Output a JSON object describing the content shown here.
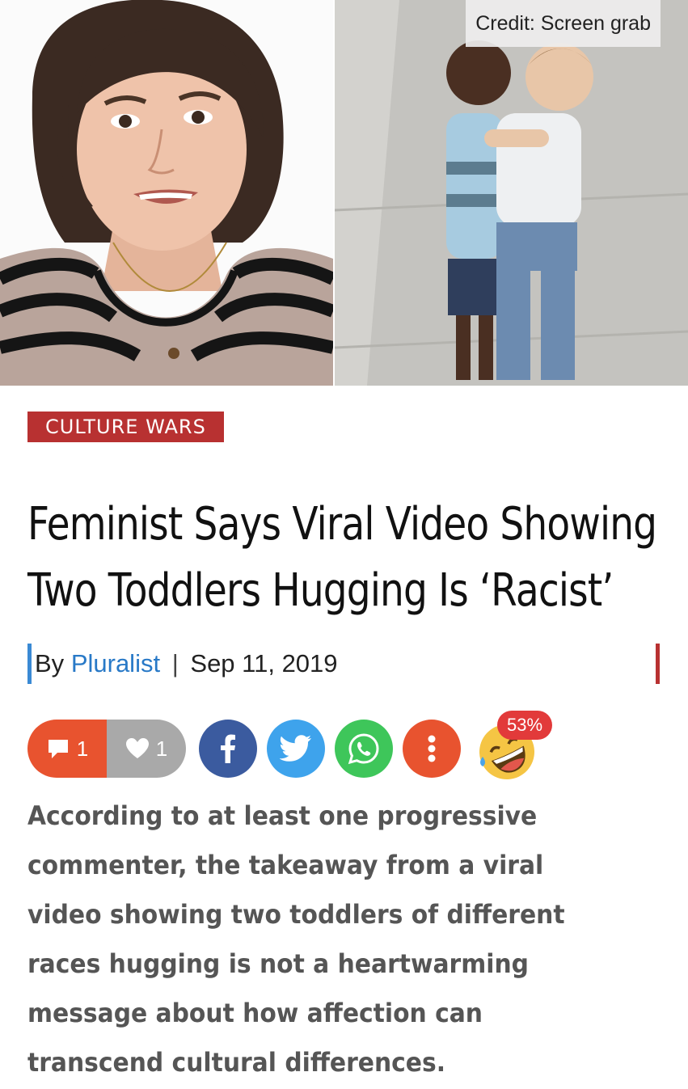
{
  "images": {
    "left_photo": "woman-portrait",
    "right_photo": "toddlers-hugging",
    "credit": "Credit: Screen grab"
  },
  "article": {
    "category": "CULTURE WARS",
    "headline": "Feminist Says Viral Video Showing Two Toddlers Hugging Is ‘Racist’",
    "byline": {
      "prefix": "By",
      "author": "Pluralist",
      "separator": "|",
      "date": "Sep 11, 2019"
    },
    "lede": "According to at least one progressive commenter, the takeaway from a viral video showing two toddlers of different races hugging is not a heartwarming message about how affection can transcend cultural differences."
  },
  "share_bar": {
    "comment_count": "1",
    "like_count": "1",
    "icons": [
      "comment-icon",
      "heart-icon",
      "facebook-icon",
      "twitter-icon",
      "whatsapp-icon",
      "more-options-icon",
      "laughing-emoji-icon"
    ],
    "reaction_percent": "53%"
  },
  "colors": {
    "category_red": "#b83131",
    "author_blue": "#2879c7",
    "facebook": "#3b5b9f",
    "twitter": "#3ea3ec",
    "whatsapp": "#3ec65a",
    "comment_orange": "#e8532f"
  }
}
